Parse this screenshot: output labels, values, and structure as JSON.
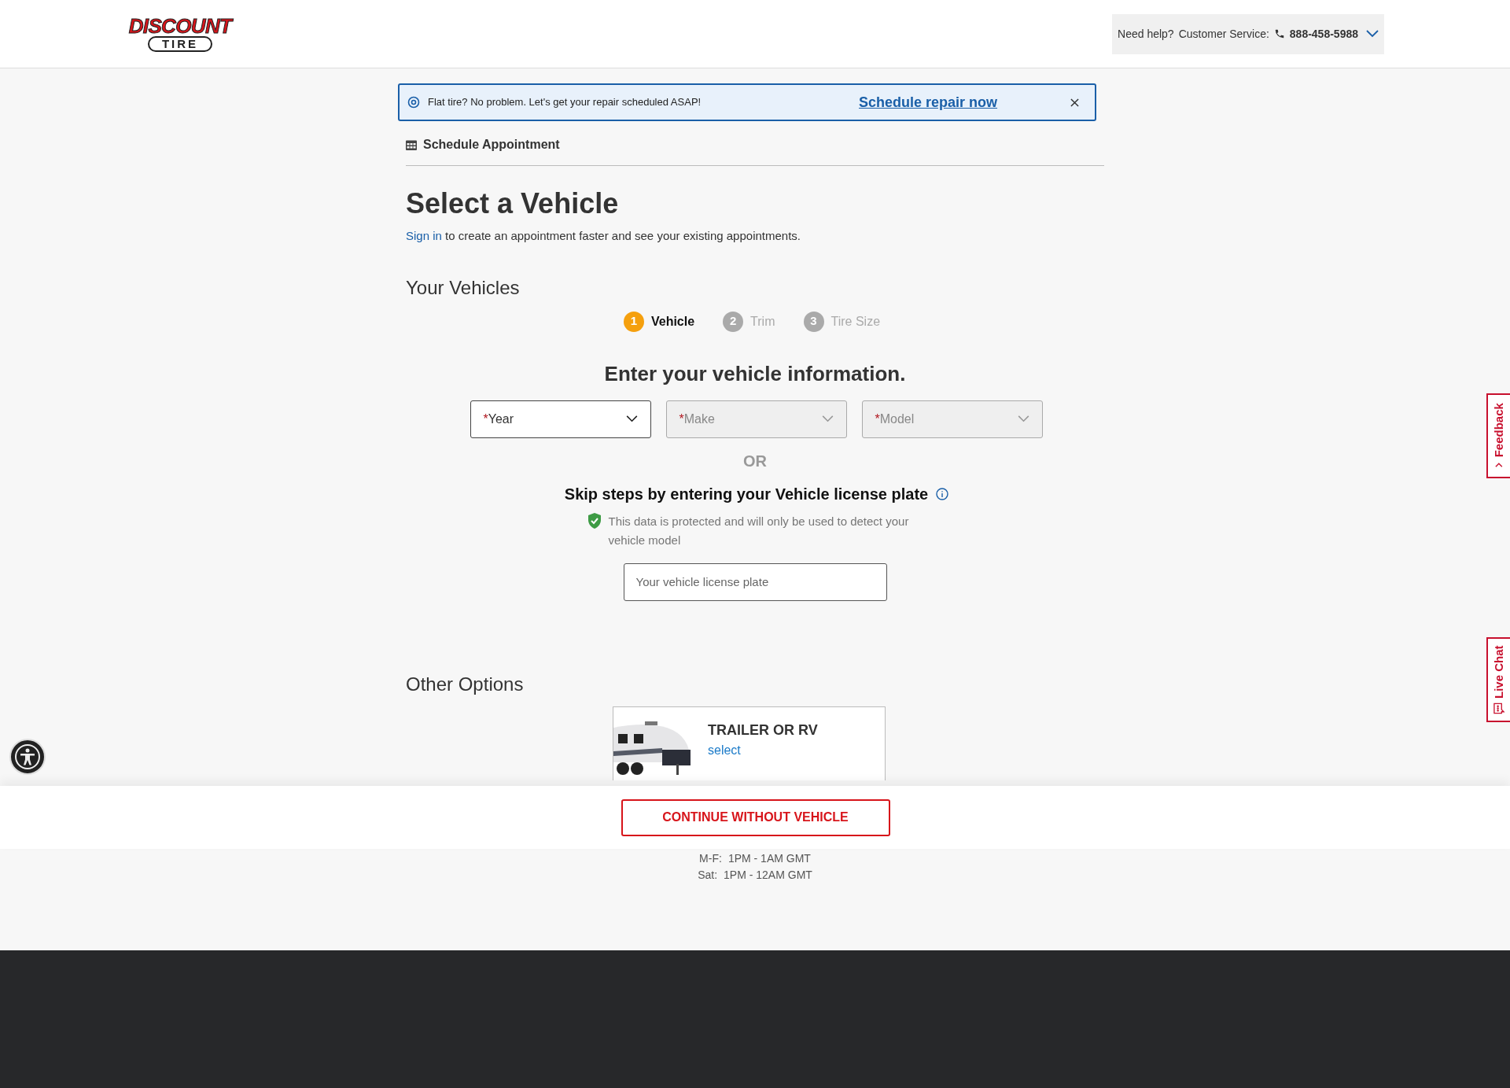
{
  "header": {
    "logo": {
      "line_1": "DISCOUNT",
      "line_2": "TIRE"
    },
    "help": {
      "label": "Need help?",
      "service_label": "Customer Service:",
      "phone": "888-458-5988"
    }
  },
  "banner": {
    "message": "Flat tire? No problem. Let's get your repair scheduled ASAP!",
    "link": "Schedule repair now"
  },
  "breadcrumb": "Schedule Appointment",
  "page_title": "Select a Vehicle",
  "sign_in": {
    "link": "Sign in",
    "text": "to create an appointment faster and see your existing appointments."
  },
  "your_vehicles": {
    "heading": "Your Vehicles",
    "steps": [
      {
        "number": "1",
        "label": "Vehicle",
        "selected": true
      },
      {
        "number": "2",
        "label": "Trim",
        "selected": false
      },
      {
        "number": "3",
        "label": "Tire Size",
        "selected": false
      }
    ],
    "form_heading": "Enter your vehicle information.",
    "selects": [
      {
        "marker": "*",
        "placeholder": "Year",
        "disabled": false
      },
      {
        "marker": "*",
        "placeholder": "Make",
        "disabled": true
      },
      {
        "marker": "*",
        "placeholder": "Model",
        "disabled": true
      }
    ],
    "or": "OR",
    "plate": {
      "heading": "Skip steps by entering your Vehicle license plate",
      "note": "This data is protected and will only be used to detect your vehicle model",
      "placeholder": "Your vehicle license plate"
    }
  },
  "other_options": {
    "heading": "Other Options",
    "cards": [
      {
        "kind": "picture",
        "title": "TRAILER OR RV",
        "link": "select"
      }
    ]
  },
  "sticky_bar": {
    "button": "CONTINUE WITHOUT VEHICLE"
  },
  "hours": [
    {
      "days": "M-F:",
      "time": "1PM - 1AM GMT"
    },
    {
      "days": "Sat:",
      "time": "1PM - 12AM GMT"
    }
  ],
  "side_tabs": [
    "Feedback",
    "Live Chat"
  ]
}
